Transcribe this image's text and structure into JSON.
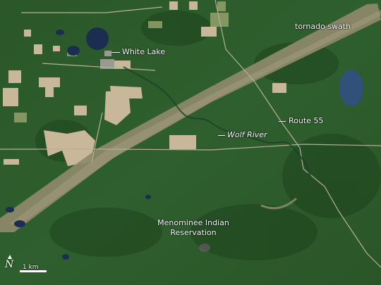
{
  "map": {
    "labels": {
      "tornado_swath": "tornado swath",
      "white_lake": "White Lake",
      "route_55": "Route 55",
      "wolf_river": "Wolf River",
      "reservation_line1": "Menominee Indian",
      "reservation_line2": "Reservation"
    },
    "scale": {
      "text": "1 km",
      "north_symbol": "N"
    },
    "colors": {
      "forest": "#2f5e2c",
      "forest_dark": "#1f4220",
      "swath": "#8f8a6f",
      "field": "#c9b89a",
      "water": "#1d2f55",
      "road": "#b7b09a"
    }
  }
}
